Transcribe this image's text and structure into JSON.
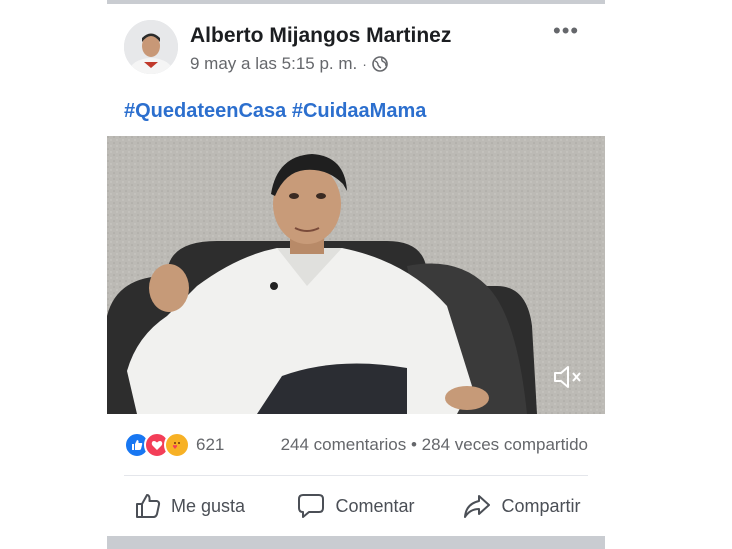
{
  "post": {
    "author": "Alberto Mijangos Martinez",
    "timestamp": "9 may a las 5:15 p. m.",
    "separator": "·",
    "privacy_icon": "globe-icon",
    "more_label": "•••",
    "hashtags": [
      "#QuedateenCasa",
      "#CuidaaMama"
    ]
  },
  "video": {
    "mute_icon": "speaker-muted-icon"
  },
  "engagement": {
    "reactions": [
      "like",
      "love",
      "care"
    ],
    "reaction_count": "621",
    "comments": "244 comentarios",
    "dot": "•",
    "shares": "284 veces compartido"
  },
  "actions": {
    "like": "Me gusta",
    "comment": "Comentar",
    "share": "Compartir"
  },
  "colors": {
    "hashtag": "#2c6fce",
    "like": "#1877f2",
    "love": "#f33e58",
    "care": "#f7b125"
  }
}
